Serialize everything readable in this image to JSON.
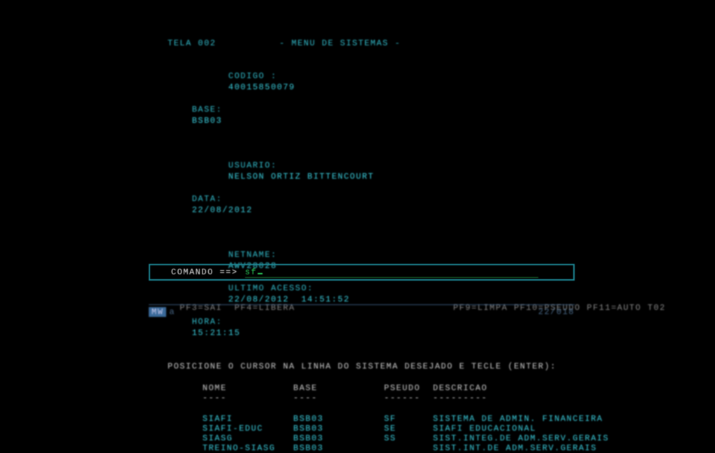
{
  "header": {
    "screen_id": "TELA 002",
    "title": "-  MENU  DE  SISTEMAS  -",
    "codigo_label": "CODIGO :",
    "codigo_value": "40015850079",
    "base_label": "BASE:",
    "base_value": "BSB03",
    "usuario_label": "USUARIO:",
    "usuario_value": "NELSON ORTIZ BITTENCOURT",
    "data_label": "DATA:",
    "data_value": "22/08/2012",
    "netname_label": "NETNAME:",
    "netname_value": "AWV28028",
    "ultimo_acesso_label": "ULTIMO ACESSO:",
    "ultimo_acesso_value": "22/08/2012  14:51:52",
    "hora_label": "HORA:",
    "hora_value": "15:21:15"
  },
  "instruction": "POSICIONE O CURSOR NA LINHA DO SISTEMA DESEJADO E TECLE (ENTER):",
  "columns": {
    "nome": "NOME",
    "base": "BASE",
    "pseudo": "PSEUDO",
    "descricao": "DESCRICAO",
    "sep_nome": "----",
    "sep_base": "----",
    "sep_pseudo": "------",
    "sep_descricao": "---------"
  },
  "systems": [
    {
      "nome": "SIAFI",
      "base": "BSB03",
      "pseudo": "SF",
      "descricao": "SISTEMA DE ADMIN. FINANCEIRA"
    },
    {
      "nome": "SIAFI-EDUC",
      "base": "BSB03",
      "pseudo": "SE",
      "descricao": "SIAFI EDUCACIONAL"
    },
    {
      "nome": "SIASG",
      "base": "BSB03",
      "pseudo": "SS",
      "descricao": "SIST.INTEG.DE ADM.SERV.GERAIS"
    },
    {
      "nome": "TREINO-SIASG",
      "base": "BSB03",
      "pseudo": "",
      "descricao": "SIST.INT.DE ADM.SERV.GERAIS"
    }
  ],
  "command": {
    "label": "COMANDO ==>",
    "value": "sf"
  },
  "fnkeys": {
    "left": "PF3=SAI  PF4=LIBERA",
    "right": "PF9=LIMPA PF10=PSEUDO PF11=AUTO T02"
  },
  "status": {
    "left": "MW",
    "mid": "a",
    "right": "22/018"
  }
}
